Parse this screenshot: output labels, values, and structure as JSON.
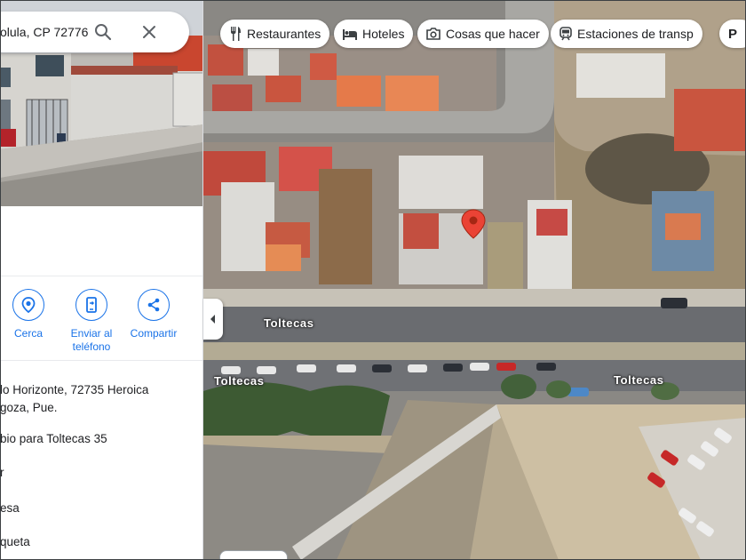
{
  "search": {
    "value": "olula, CP 72776 P"
  },
  "actions": [
    {
      "label": "Cerca"
    },
    {
      "label": "Enviar al teléfono"
    },
    {
      "label": "Compartir"
    }
  ],
  "info": {
    "address_line1": "lo Horizonte, 72735 Heroica",
    "address_line2": "goza, Pue.",
    "plus_code": "bio para Toltecas 35",
    "item3": "r",
    "item4": "esa",
    "item5": "queta"
  },
  "chips": [
    {
      "label": "Restaurantes",
      "icon": "restaurant-icon"
    },
    {
      "label": "Hoteles",
      "icon": "hotel-icon"
    },
    {
      "label": "Cosas que hacer",
      "icon": "camera-icon"
    },
    {
      "label": "Estaciones de transp",
      "icon": "transit-icon"
    },
    {
      "label": "P",
      "icon": "parking-icon"
    }
  ],
  "map": {
    "road_labels": [
      "Toltecas",
      "Toltecas",
      "Toltecas"
    ],
    "pin_color": "#ea4335"
  },
  "colors": {
    "accent": "#1a73e8"
  }
}
